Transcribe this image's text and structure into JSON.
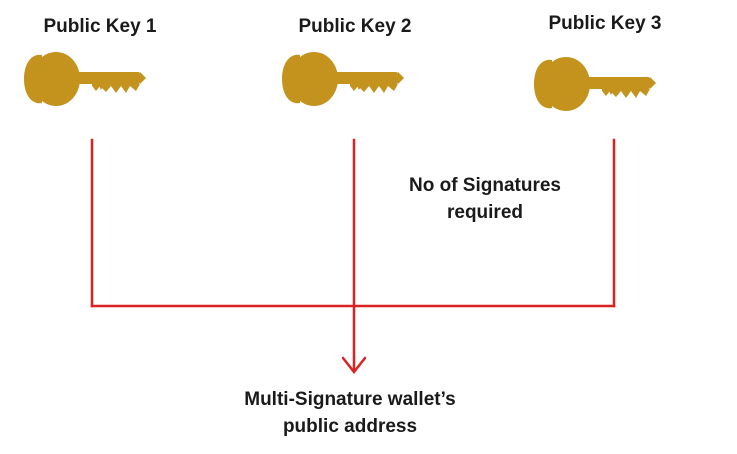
{
  "keys": [
    {
      "label": "Public Key 1"
    },
    {
      "label": "Public Key 2"
    },
    {
      "label": "Public Key 3"
    }
  ],
  "signatures_note": "No of Signatures required",
  "result": {
    "line1": "Multi-Signature wallet’s",
    "line2": "public address"
  },
  "colors": {
    "key": "#c4931d",
    "key_shadow": "#a67710",
    "connector": "#d92323",
    "text": "#1a1a1a"
  },
  "icons": [
    "key-icon",
    "arrow-down-icon"
  ]
}
